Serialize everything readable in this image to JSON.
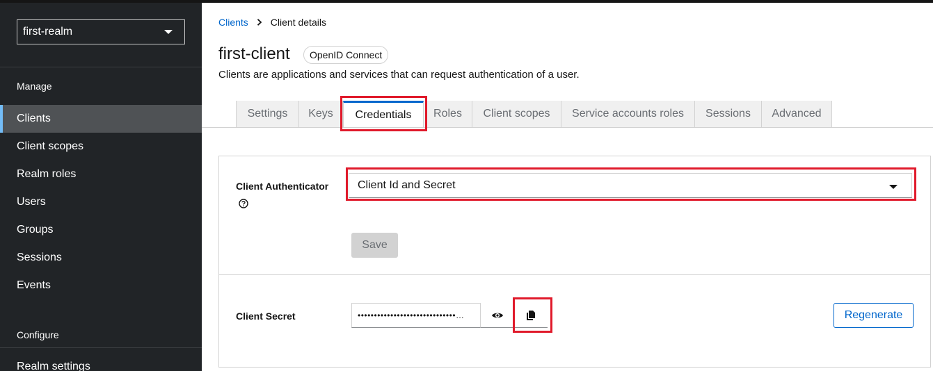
{
  "sidebar": {
    "realm": "first-realm",
    "manage_heading": "Manage",
    "items": [
      {
        "label": "Clients",
        "active": true
      },
      {
        "label": "Client scopes"
      },
      {
        "label": "Realm roles"
      },
      {
        "label": "Users"
      },
      {
        "label": "Groups"
      },
      {
        "label": "Sessions"
      },
      {
        "label": "Events"
      }
    ],
    "configure_heading": "Configure",
    "configure_items": [
      {
        "label": "Realm settings"
      }
    ]
  },
  "breadcrumb": {
    "parent": "Clients",
    "current": "Client details"
  },
  "header": {
    "title": "first-client",
    "badge": "OpenID Connect",
    "subtitle": "Clients are applications and services that can request authentication of a user."
  },
  "tabs": [
    {
      "label": "Settings"
    },
    {
      "label": "Keys"
    },
    {
      "label": "Credentials",
      "active": true
    },
    {
      "label": "Roles"
    },
    {
      "label": "Client scopes"
    },
    {
      "label": "Service accounts roles"
    },
    {
      "label": "Sessions"
    },
    {
      "label": "Advanced"
    }
  ],
  "credentials": {
    "authenticator_label": "Client Authenticator",
    "authenticator_value": "Client Id and Secret",
    "save_label": "Save",
    "secret_label": "Client Secret",
    "secret_value": "••••••••••••••••••••••••••••••…",
    "regenerate_label": "Regenerate"
  },
  "icons": {
    "help": "help-icon",
    "show": "eye-icon",
    "copy": "copy-icon",
    "chevron": "chevron-right-icon",
    "caret": "caret-down-icon"
  },
  "colors": {
    "sidebar_bg": "#212427",
    "active_item_bg": "#4f5255",
    "link": "#0066cc",
    "highlight": "#e01a2b"
  }
}
